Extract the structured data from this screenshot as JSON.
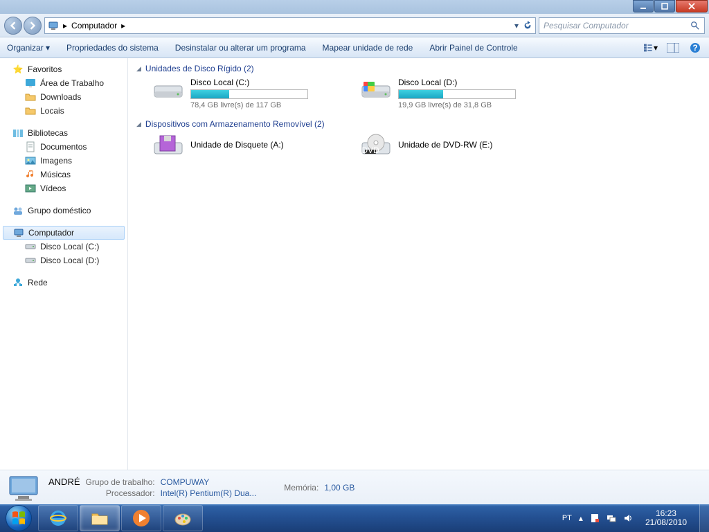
{
  "titlebar": {
    "min": "–",
    "max": "☐",
    "close": "✕"
  },
  "nav": {
    "crumb_root": "Computador",
    "search_placeholder": "Pesquisar Computador"
  },
  "toolbar": {
    "organize": "Organizar ▾",
    "system_props": "Propriedades do sistema",
    "uninstall": "Desinstalar ou alterar um programa",
    "map_drive": "Mapear unidade de rede",
    "control_panel": "Abrir Painel de Controle"
  },
  "sidebar": {
    "favorites": "Favoritos",
    "fav_items": [
      "Área de Trabalho",
      "Downloads",
      "Locais"
    ],
    "libraries": "Bibliotecas",
    "lib_items": [
      "Documentos",
      "Imagens",
      "Músicas",
      "Vídeos"
    ],
    "homegroup": "Grupo doméstico",
    "computer": "Computador",
    "comp_items": [
      "Disco Local (C:)",
      "Disco Local (D:)"
    ],
    "network": "Rede"
  },
  "content": {
    "cat1": "Unidades de Disco Rígido (2)",
    "drives": [
      {
        "name": "Disco Local (C:)",
        "sub": "78,4 GB livre(s) de 117 GB",
        "fill": 33
      },
      {
        "name": "Disco Local (D:)",
        "sub": "19,9 GB livre(s) de 31,8 GB",
        "fill": 38
      }
    ],
    "cat2": "Dispositivos com Armazenamento Removível (2)",
    "removable": [
      {
        "name": "Unidade de Disquete (A:)"
      },
      {
        "name": "Unidade de DVD-RW (E:)"
      }
    ]
  },
  "details": {
    "name": "ANDRÉ",
    "workgroup_label": "Grupo de trabalho:",
    "workgroup": "COMPUWAY",
    "proc_label": "Processador:",
    "proc": "Intel(R) Pentium(R) Dua...",
    "mem_label": "Memória:",
    "mem": "1,00 GB"
  },
  "taskbar": {
    "lang": "PT",
    "time": "16:23",
    "date": "21/08/2010"
  }
}
